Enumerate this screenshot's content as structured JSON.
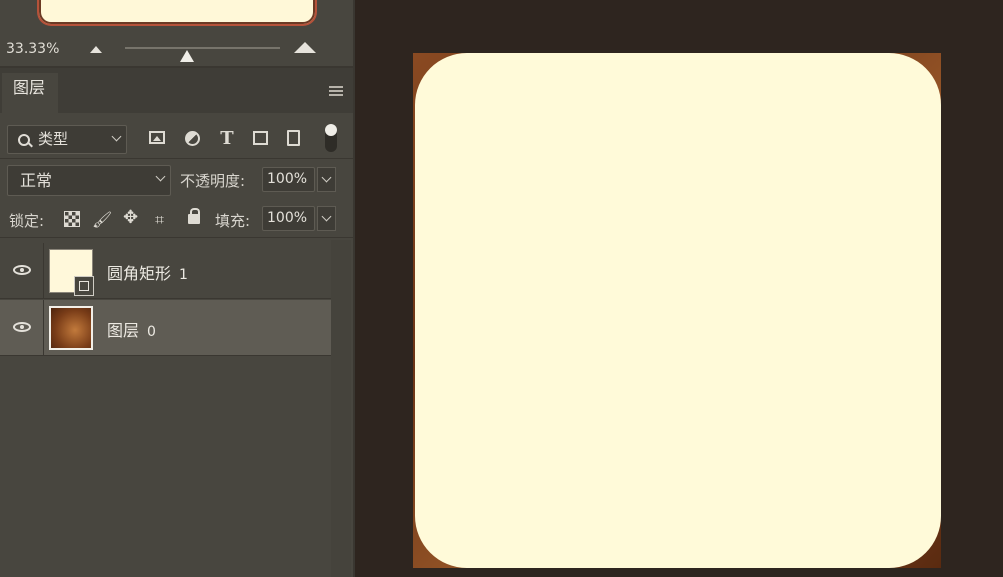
{
  "navigator": {
    "zoom": "33.33%",
    "slider_position": 0.4
  },
  "layers_panel": {
    "tab_label": "图层",
    "filter": {
      "label": "类型"
    },
    "blend_mode": "正常",
    "opacity_label": "不透明度:",
    "opacity_value": "100%",
    "lock_label": "锁定:",
    "fill_label": "填充:",
    "fill_value": "100%",
    "layers": [
      {
        "name": "圆角矩形",
        "number": "1",
        "selected": false,
        "thumbnail": "cream-rounded-rectangle"
      },
      {
        "name": "图层",
        "number": "0",
        "selected": true,
        "thumbnail": "wood-texture"
      }
    ]
  },
  "colors": {
    "panel_bg": "#48463f",
    "canvas_bg": "#2e251f",
    "rect_fill": "#fffad9",
    "selected_row": "#5f5c54"
  }
}
